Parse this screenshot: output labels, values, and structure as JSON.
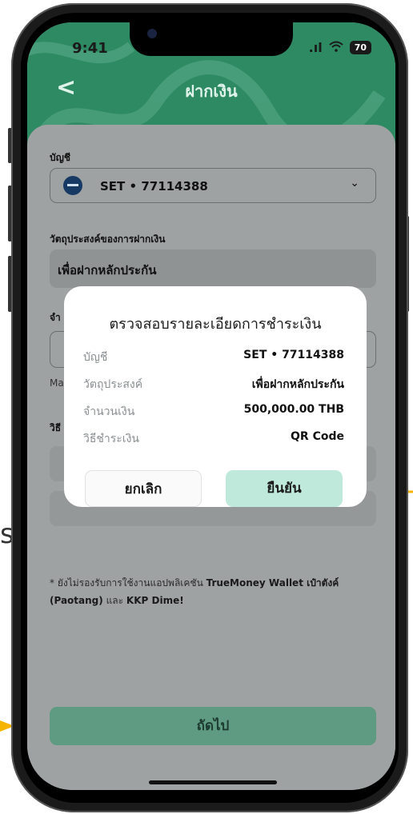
{
  "status": {
    "time": "9:41",
    "battery": "70"
  },
  "header": {
    "title": "ฝากเงิน"
  },
  "form": {
    "account_label": "บัญชี",
    "account_value": "SET • 77114388",
    "purpose_label": "วัตถุประสงค์ของการฝากเงิน",
    "purpose_value": "เพื่อฝากหลักประกัน",
    "amount_label_partial": "จำ",
    "min_partial": "Ma",
    "method_label_partial": "วิธี"
  },
  "note": {
    "text_prefix": "* ยังไม่รองรับการใช้งานแอปพลิเคชัน ",
    "app1": "TrueMoney Wallet เป๋าตังค์",
    "app2": "(Paotang)",
    "and": " และ ",
    "app3": "KKP Dime!"
  },
  "next_button": "ถัดไป",
  "modal": {
    "title": "ตรวจสอบรายละเอียดการชำระเงิน",
    "rows": [
      {
        "label": "บัญชี",
        "value": "SET • 77114388"
      },
      {
        "label": "วัตถุประสงค์",
        "value": "เพื่อฝากหลักประกัน"
      },
      {
        "label": "จำนวนเงิน",
        "value": "500,000.00 THB"
      },
      {
        "label": "วิธีชำระเงิน",
        "value": "QR Code"
      }
    ],
    "cancel": "ยกเลิก",
    "confirm": "ยืนยัน"
  },
  "side_letter": "s",
  "colors": {
    "brand_green": "#2d8a63",
    "confirm_bg": "#bfeadb",
    "arrow": "#f5b400"
  }
}
